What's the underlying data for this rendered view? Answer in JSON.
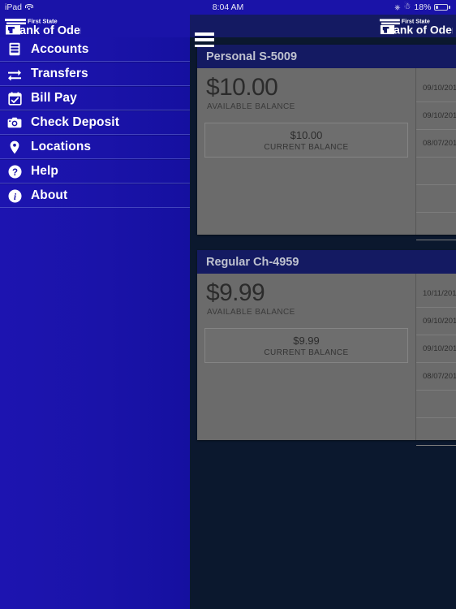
{
  "status_bar": {
    "device": "iPad",
    "wifi_icon": "wifi-icon",
    "time": "8:04 AM",
    "orientation_lock_icon": "rotation-lock-icon",
    "bluetooth_icon": "bluetooth-icon",
    "battery_percent": "18%",
    "battery_icon": "battery-icon"
  },
  "nav_bar": {
    "menu_icon": "hamburger-menu-icon",
    "logo_line1": "First State",
    "logo_line2": "ank of Odem",
    "logo_full": "First State Bank of Odem"
  },
  "sidebar": {
    "items": [
      {
        "label": "Accounts",
        "icon": "accounts-icon"
      },
      {
        "label": "Transfers",
        "icon": "transfers-icon"
      },
      {
        "label": "Bill Pay",
        "icon": "bill-pay-icon"
      },
      {
        "label": "Check Deposit",
        "icon": "check-deposit-icon"
      },
      {
        "label": "Locations",
        "icon": "location-pin-icon"
      },
      {
        "label": "Help",
        "icon": "help-question-icon"
      },
      {
        "label": "About",
        "icon": "about-info-icon"
      }
    ]
  },
  "accounts": [
    {
      "title": "Personal S-5009",
      "available_amount": "$10.00",
      "available_label": "AVAILABLE BALANCE",
      "current_amount": "$10.00",
      "current_label": "CURRENT BALANCE",
      "transactions": [
        {
          "date": "09/10/201"
        },
        {
          "date": "09/10/201"
        },
        {
          "date": "08/07/201"
        },
        {
          "date": ""
        },
        {
          "date": ""
        },
        {
          "date": ""
        }
      ]
    },
    {
      "title": "Regular Ch-4959",
      "available_amount": "$9.99",
      "available_label": "AVAILABLE BALANCE",
      "current_amount": "$9.99",
      "current_label": "CURRENT BALANCE",
      "transactions": [
        {
          "date": "10/11/201"
        },
        {
          "date": "09/10/201"
        },
        {
          "date": "09/10/201"
        },
        {
          "date": "08/07/201"
        },
        {
          "date": ""
        },
        {
          "date": ""
        }
      ]
    }
  ],
  "colors": {
    "brand_blue": "#1a13a8",
    "nav_dark": "#141a62",
    "content_bg": "#0b182e",
    "card_gray": "#6b6b6b",
    "text_white": "#ffffff"
  }
}
